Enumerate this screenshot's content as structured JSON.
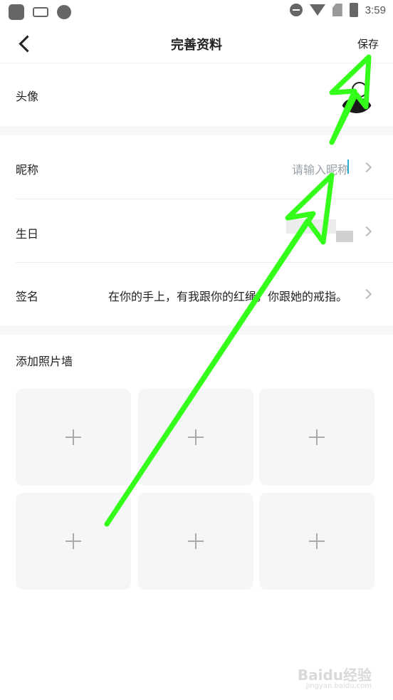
{
  "status_bar": {
    "time": "3:59"
  },
  "nav": {
    "title": "完善资料",
    "save_label": "保存"
  },
  "form": {
    "avatar_label": "头像",
    "nickname_label": "昵称",
    "nickname_placeholder": "请输入昵称",
    "birthday_label": "生日",
    "signature_label": "签名",
    "signature_value": "在你的手上，有我跟你的红绳，你跟她的戒指。"
  },
  "photo_wall": {
    "title": "添加照片墙",
    "slots": 6
  },
  "watermark": {
    "text": "Baidu经验",
    "sub": "jingyan.baidu.com"
  },
  "colors": {
    "annotation_arrow": "#33ff1a",
    "accent_cursor": "#2ab0d8"
  }
}
